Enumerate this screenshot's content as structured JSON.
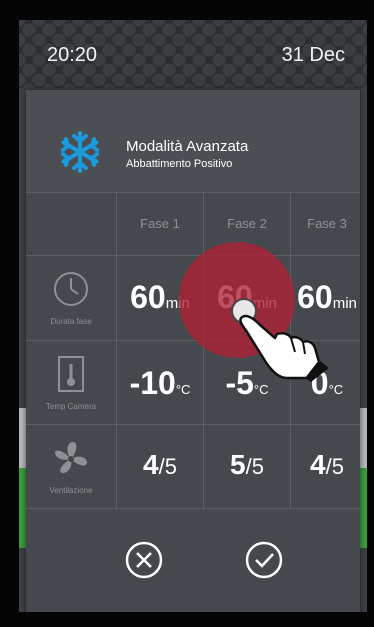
{
  "status": {
    "time": "20:20",
    "date": "31 Dec"
  },
  "header": {
    "icon": "snowflake-icon",
    "title": "Modalità Avanzata",
    "subtitle": "Abbattimento Positivo",
    "accent": "#1a9be0"
  },
  "columns": [
    "Fase 1",
    "Fase 2",
    "Fase 3"
  ],
  "rows": [
    {
      "icon": "clock-icon",
      "label": "Durata fase",
      "cells": [
        {
          "value": "60",
          "unit": "min"
        },
        {
          "value": "60",
          "unit": "min"
        },
        {
          "value": "60",
          "unit": "min"
        }
      ]
    },
    {
      "icon": "thermometer-icon",
      "label": "Temp Camera",
      "cells": [
        {
          "value": "-10",
          "unit": "°C"
        },
        {
          "value": "-5",
          "unit": "°C"
        },
        {
          "value": "0",
          "unit": "°C"
        }
      ]
    },
    {
      "icon": "fan-icon",
      "label": "Ventilazione",
      "cells": [
        {
          "value": "4",
          "unit": "/5"
        },
        {
          "value": "5",
          "unit": "/5"
        },
        {
          "value": "4",
          "unit": "/5"
        }
      ]
    }
  ],
  "footer": {
    "cancel_icon": "cancel-icon",
    "confirm_icon": "confirm-icon"
  },
  "touch_indicator": {
    "color": "#b02034"
  }
}
